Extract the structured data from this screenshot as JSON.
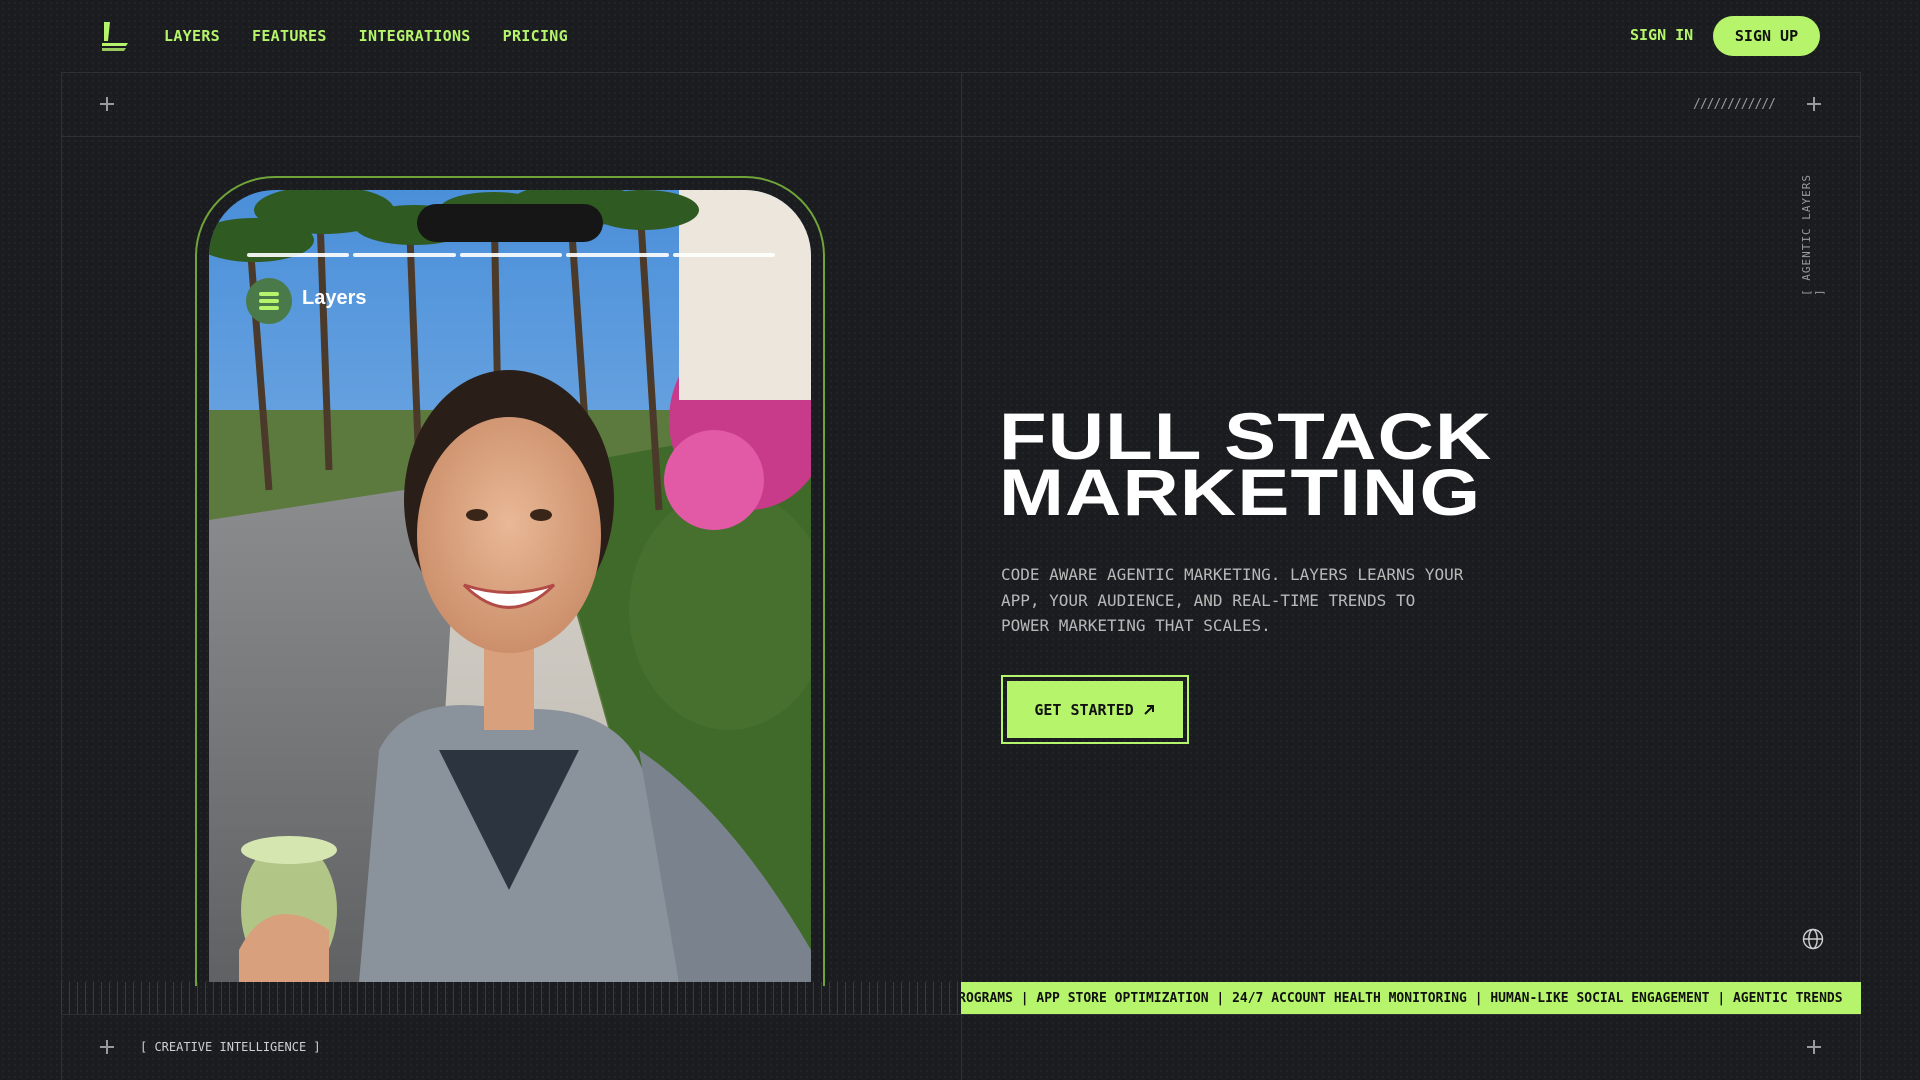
{
  "nav": {
    "logo_icon": "layers-stack-logo-icon",
    "links": [
      "LAYERS",
      "FEATURES",
      "INTEGRATIONS",
      "PRICING"
    ],
    "sign_in": "SIGN IN",
    "sign_up": "SIGN UP"
  },
  "decor": {
    "slashes": "////////////",
    "vertical_label": "[ AGENTIC LAYERS ]",
    "bottom_label": "[ CREATIVE INTELLIGENCE ]"
  },
  "phone": {
    "brand_name": "Layers",
    "story_segments": 5
  },
  "hero": {
    "title_line1": "FULL STACK",
    "title_line2": "MARKETING",
    "description": "CODE AWARE AGENTIC MARKETING. LAYERS LEARNS YOUR APP, YOUR AUDIENCE, AND REAL-TIME TRENDS TO POWER MARKETING THAT SCALES.",
    "cta_label": "GET STARTED"
  },
  "ticker": {
    "text": "TOR PROGRAMS | APP STORE OPTIMIZATION | 24/7 ACCOUNT HEALTH MONITORING | HUMAN-LIKE SOCIAL ENGAGEMENT | AGENTIC TRENDS"
  },
  "colors": {
    "accent": "#b6f56b",
    "background": "#1b1c1f",
    "phone_border": "#6fa43a"
  }
}
